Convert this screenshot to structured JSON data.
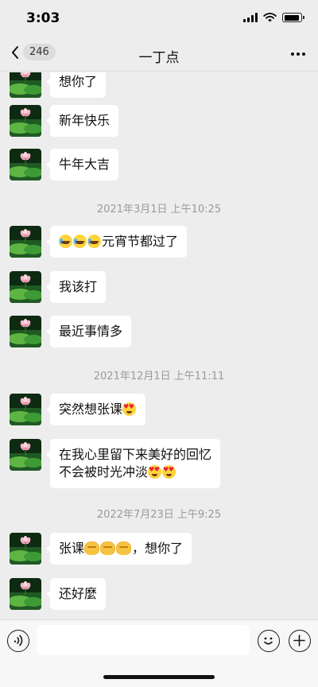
{
  "status_bar": {
    "time": "3:03",
    "battery_level": 0.9
  },
  "nav": {
    "back_count": "246",
    "title": "一丁点",
    "icons": [
      "chevron-left-icon",
      "more-icon"
    ]
  },
  "messages": [
    {
      "type": "text",
      "sender": "other",
      "text": "想你了"
    },
    {
      "type": "text",
      "sender": "other",
      "text": "新年快乐"
    },
    {
      "type": "text",
      "sender": "other",
      "text": "牛年大吉"
    },
    {
      "type": "time",
      "text": "2021年3月1日 上午10:25"
    },
    {
      "type": "text",
      "sender": "other",
      "emoji_prefix": [
        "crying-laughing-emoji",
        "crying-laughing-emoji",
        "crying-laughing-emoji"
      ],
      "text": "元宵节都过了"
    },
    {
      "type": "text",
      "sender": "other",
      "text": "我该打"
    },
    {
      "type": "text",
      "sender": "other",
      "text": "最近事情多"
    },
    {
      "type": "time",
      "text": "2021年12月1日 上午11:11"
    },
    {
      "type": "text",
      "sender": "other",
      "text": "突然想张课",
      "emoji_suffix": [
        "heart-eyes-emoji"
      ]
    },
    {
      "type": "text",
      "sender": "other",
      "text": "在我心里留下来美好的回忆\n不会被时光冲淡",
      "emoji_suffix": [
        "heart-eyes-emoji",
        "heart-eyes-emoji"
      ]
    },
    {
      "type": "time",
      "text": "2022年7月23日 上午9:25"
    },
    {
      "type": "text",
      "sender": "other",
      "text_before": "张课",
      "emoji_mid": [
        "handshake-emoji",
        "handshake-emoji",
        "handshake-emoji"
      ],
      "text_after": "，想你了"
    },
    {
      "type": "text",
      "sender": "other",
      "text": "还好麼"
    }
  ],
  "input_bar": {
    "value": "",
    "icons": [
      "voice-icon",
      "emoji-icon",
      "plus-icon"
    ]
  },
  "colors": {
    "background": "#ededed",
    "bubble": "#ffffff",
    "timestamp": "#9a9a9a"
  }
}
